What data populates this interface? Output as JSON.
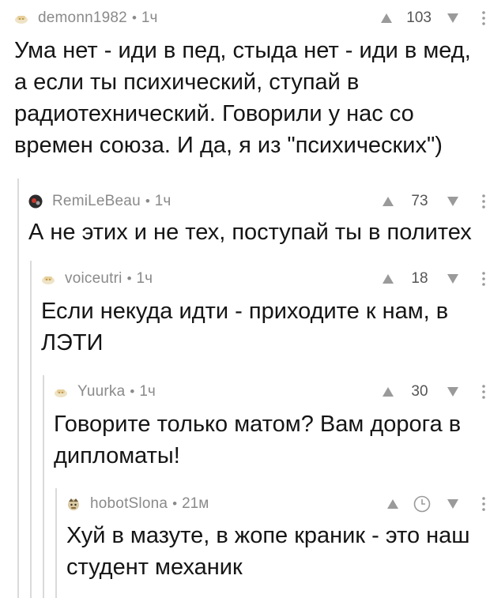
{
  "comments": [
    {
      "author": "demonn1982",
      "separator": "•",
      "time": "1ч",
      "score": "103",
      "text": "Ума нет - иди в пед, стыда нет - иди в мед, а если ты психический, ступай в радиотехнический. Говорили у нас со времен союза. И да, я из \"психических\")",
      "avatar_icon": "default-avatar-icon"
    },
    {
      "author": "RemiLeBeau",
      "separator": "•",
      "time": "1ч",
      "score": "73",
      "text": "А не этих и не тех, поступай ты в политех",
      "avatar_icon": "user-avatar-icon"
    },
    {
      "author": "voiceutri",
      "separator": "•",
      "time": "1ч",
      "score": "18",
      "text": "Если некуда идти - приходите к нам, в ЛЭТИ",
      "avatar_icon": "default-avatar-icon"
    },
    {
      "author": "Yuurka",
      "separator": "•",
      "time": "1ч",
      "score": "30",
      "text": "Говорите только матом? Вам дорога в дипломаты!",
      "avatar_icon": "default-avatar-icon"
    },
    {
      "author": "hobotSlona",
      "separator": "•",
      "time": "21м",
      "score": "",
      "text": "Хуй в мазуте, в жопе краник - это наш студент механик",
      "avatar_icon": "user-avatar-icon",
      "score_hidden_icon": "clock-icon"
    }
  ],
  "colors": {
    "text": "#151515",
    "meta": "#8a8a8a",
    "thread_line": "#dadada",
    "icon": "#9a9a9a"
  }
}
